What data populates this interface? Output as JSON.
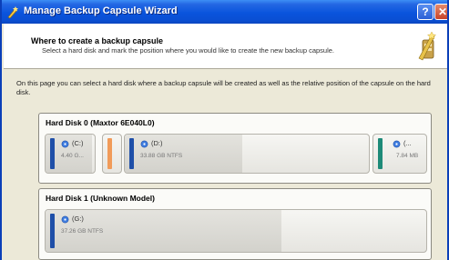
{
  "window": {
    "title": "Manage Backup Capsule Wizard",
    "help_symbol": "?",
    "close_symbol": "✕"
  },
  "header": {
    "title": "Where to create a backup capsule",
    "subtitle": "Select a hard disk and mark the position where you would like to create the new backup capsule."
  },
  "intro_text": "On this page you can select a hard disk where a backup capsule will be created as well as the relative position of the capsule on the hard disk.",
  "disks": [
    {
      "name": "Hard Disk 0 (Maxtor 6E040L0)",
      "partitions": [
        {
          "label": "(C:)",
          "size": "4.40 G...",
          "color": "#1f4fa8",
          "used_fraction": 0.95
        },
        {
          "label": "",
          "size": "",
          "color": "#f19b59",
          "used_fraction": 0
        },
        {
          "label": "(D:)",
          "size": "33.88 GB NTFS",
          "color": "#1f4fa8",
          "used_fraction": 0.48
        },
        {
          "label": "(...",
          "size": "7.84 MB",
          "color": "#1d8a78",
          "used_fraction": 0
        }
      ]
    },
    {
      "name": "Hard Disk 1 (Unknown Model)",
      "partitions": [
        {
          "label": "(G:)",
          "size": "37.26 GB NTFS",
          "color": "#1f4fa8",
          "used_fraction": 0.62
        }
      ]
    }
  ],
  "colors": {
    "title_bar": "#0a54dd",
    "primary_partition": "#1f4fa8",
    "unallocated": "#f19b59",
    "other_partition": "#1d8a78"
  },
  "icons": {
    "app": "wizard-wand-icon",
    "header": "backup-wizard-icon",
    "volume": "drive-volume-icon"
  }
}
